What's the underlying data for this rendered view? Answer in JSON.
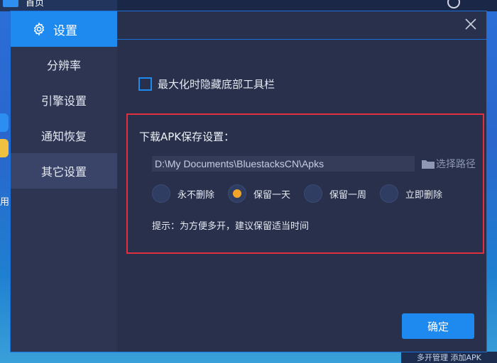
{
  "background": {
    "tab_label": "首页",
    "left_text": "用",
    "bottom_text": "多开管理  添加APK"
  },
  "sidebar": {
    "title": "设置",
    "items": [
      {
        "label": "分辨率",
        "active": false
      },
      {
        "label": "引擎设置",
        "active": false
      },
      {
        "label": "通知恢复",
        "active": false
      },
      {
        "label": "其它设置",
        "active": true
      }
    ]
  },
  "content": {
    "checkbox_label": "最大化时隐藏底部工具栏",
    "apk": {
      "title": "下载APK保存设置：",
      "path_value": "D:\\My Documents\\BluestacksCN\\Apks",
      "browse_label": "选择路径",
      "options": [
        {
          "label": "永不删除",
          "selected": false
        },
        {
          "label": "保留一天",
          "selected": true
        },
        {
          "label": "保留一周",
          "selected": false
        },
        {
          "label": "立即删除",
          "selected": false
        }
      ],
      "hint": "提示：为方便多开，建议保留适当时间"
    },
    "confirm_label": "确定"
  },
  "colors": {
    "accent": "#1e8af0",
    "highlight_border": "#e03040",
    "radio_selected": "#f2a42a"
  }
}
